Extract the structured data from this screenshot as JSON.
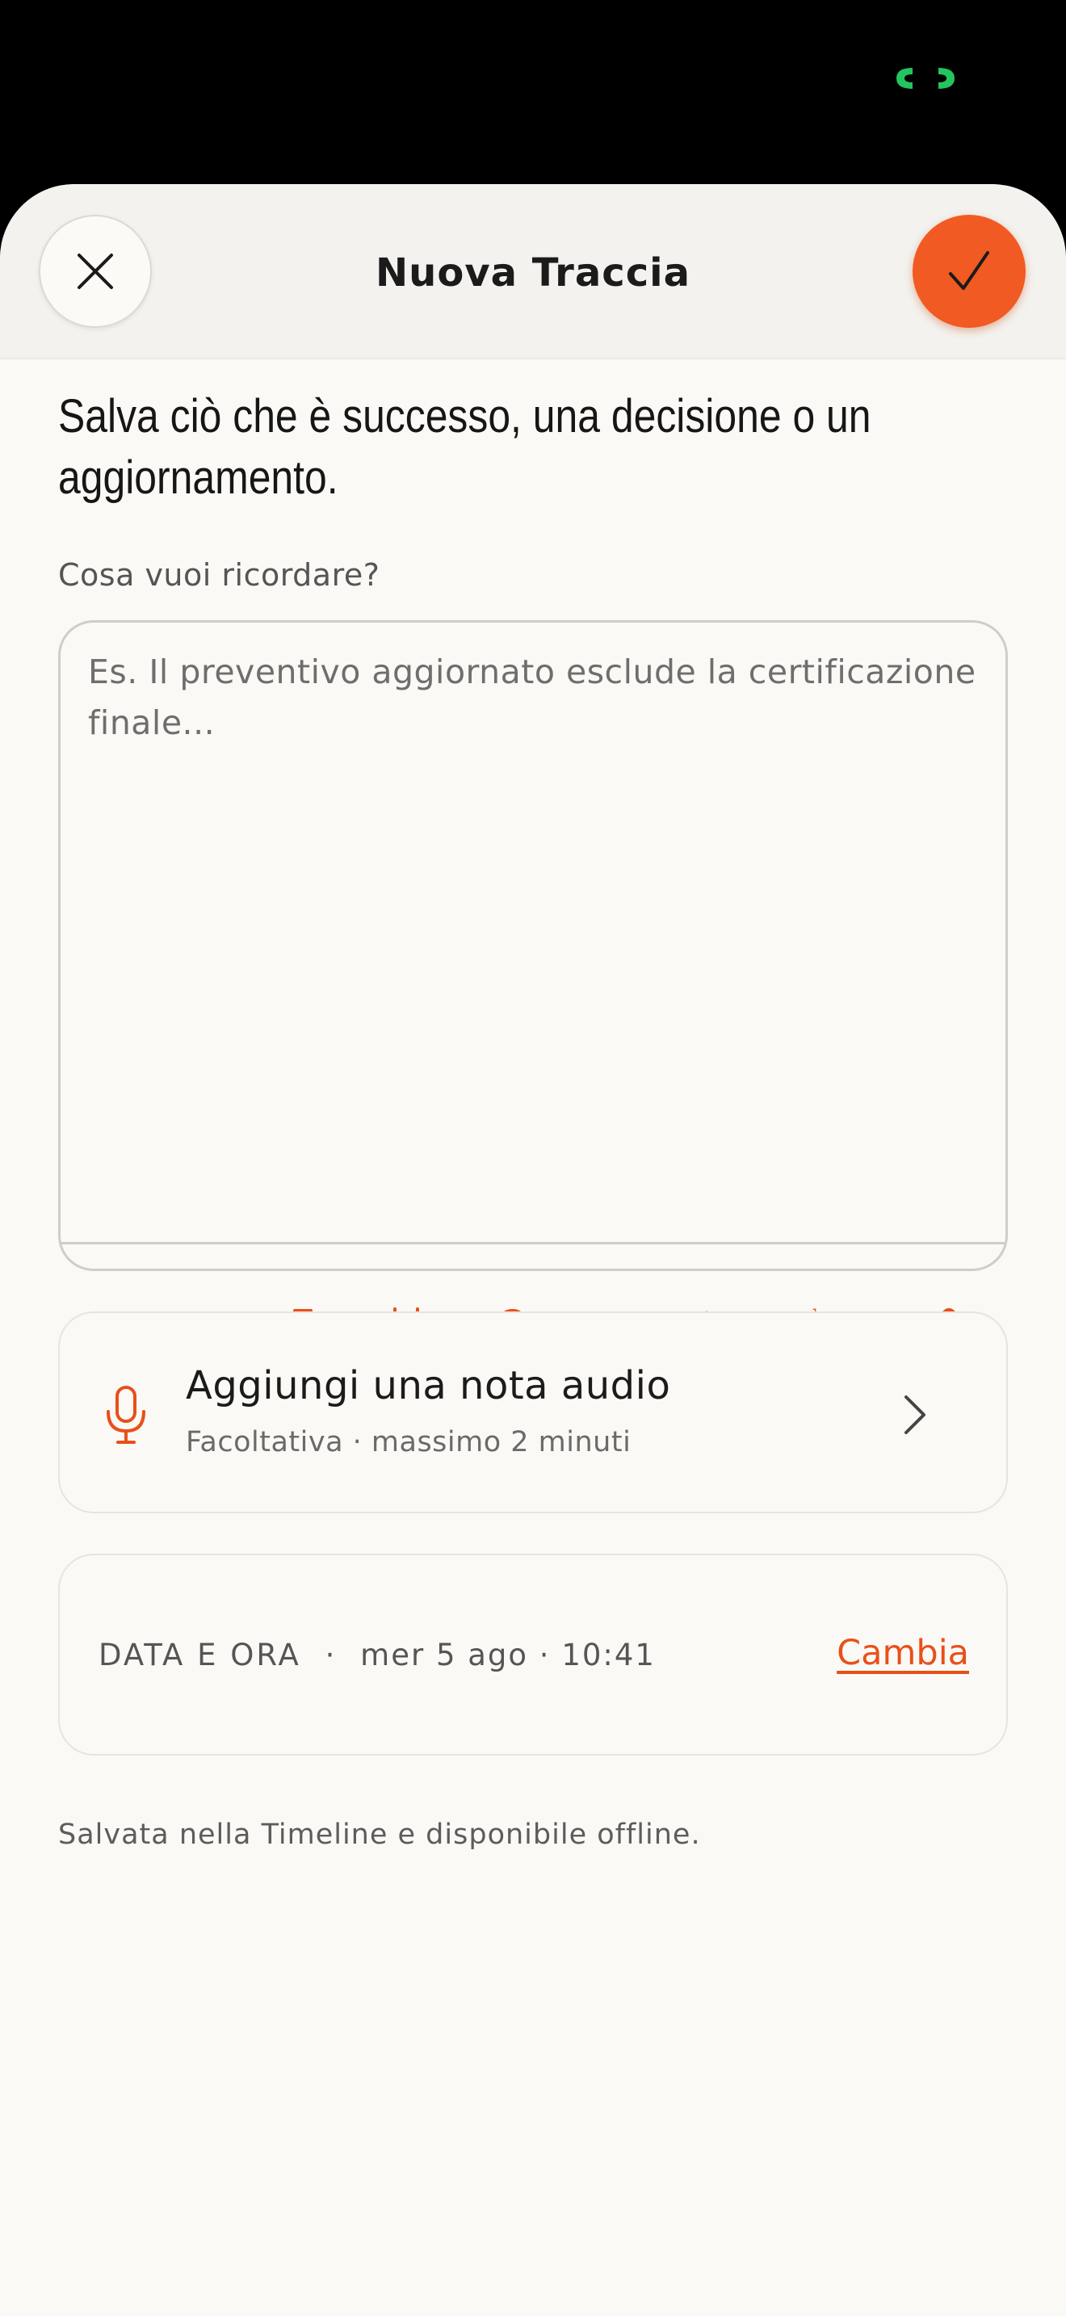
{
  "colors": {
    "accent": "#f15a22",
    "accent_text": "#e8501a",
    "status_indicator": "#22c55e",
    "background": "#fbf9f5"
  },
  "header": {
    "title": "Nuova Traccia",
    "close_icon": "close-icon",
    "confirm_icon": "checkmark-icon"
  },
  "headline": "Salva ciò che è successo, una decisione o un aggiornamento.",
  "editor": {
    "label": "Cosa vuoi ricordare?",
    "placeholder": "Es. Il preventivo aggiornato esclude la certificazione finale...",
    "toolbar": [
      "bold-icon",
      "italic-icon",
      "underline-icon",
      "strikethrough-icon",
      "highlight-pen-icon",
      "bulleted-list-icon",
      "numbered-list-icon",
      "link-icon",
      "clear-format-icon",
      "undo-icon",
      "redo-icon"
    ]
  },
  "audio_note": {
    "title": "Aggiungi una nota audio",
    "subtitle": "Facoltativa · massimo 2 minuti",
    "icon": "microphone-icon"
  },
  "date_time": {
    "label": "DATA E ORA",
    "separator": "·",
    "value": "mer 5 ago · 10:41",
    "action": "Cambia"
  },
  "footer_note": "Salvata nella Timeline e disponibile offline."
}
